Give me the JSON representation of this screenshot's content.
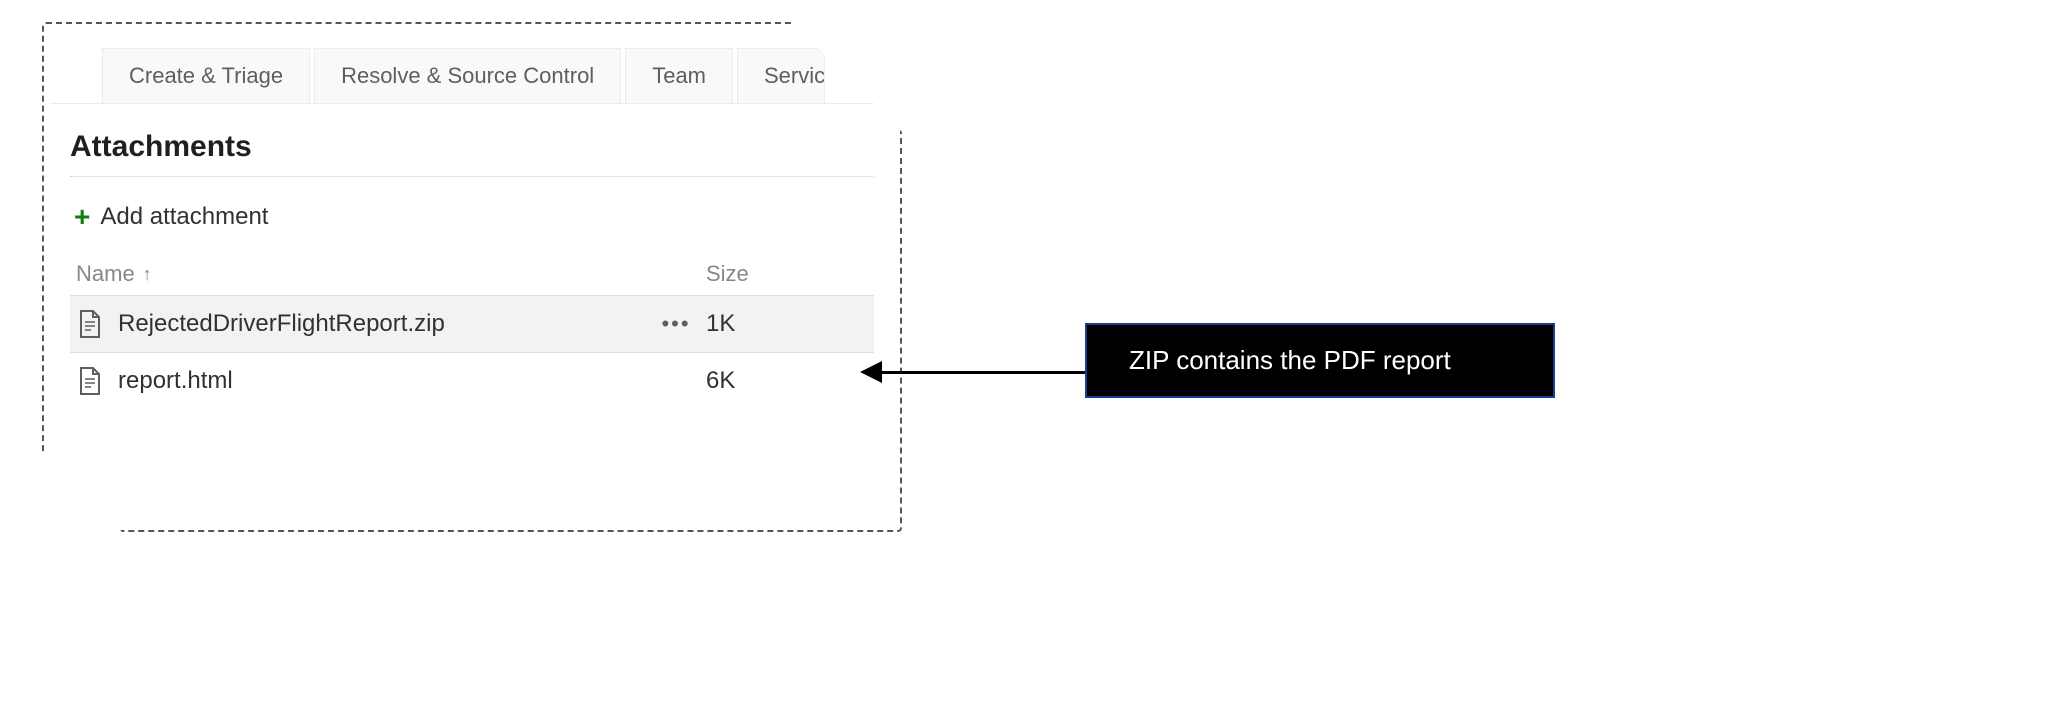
{
  "tabs": [
    {
      "label": "Create & Triage"
    },
    {
      "label": "Resolve & Source Control"
    },
    {
      "label": "Team"
    },
    {
      "label": "Servicing"
    }
  ],
  "section_title": "Attachments",
  "add_attachment_label": "Add attachment",
  "columns": {
    "name": "Name",
    "size": "Size"
  },
  "sort_indicator": "↑",
  "more_glyph": "•••",
  "rows": [
    {
      "filename": "RejectedDriverFlightReport.zip",
      "size": "1K",
      "selected": true
    },
    {
      "filename": "report.html",
      "size": "6K",
      "selected": false
    }
  ],
  "annotation": "ZIP contains the PDF report"
}
